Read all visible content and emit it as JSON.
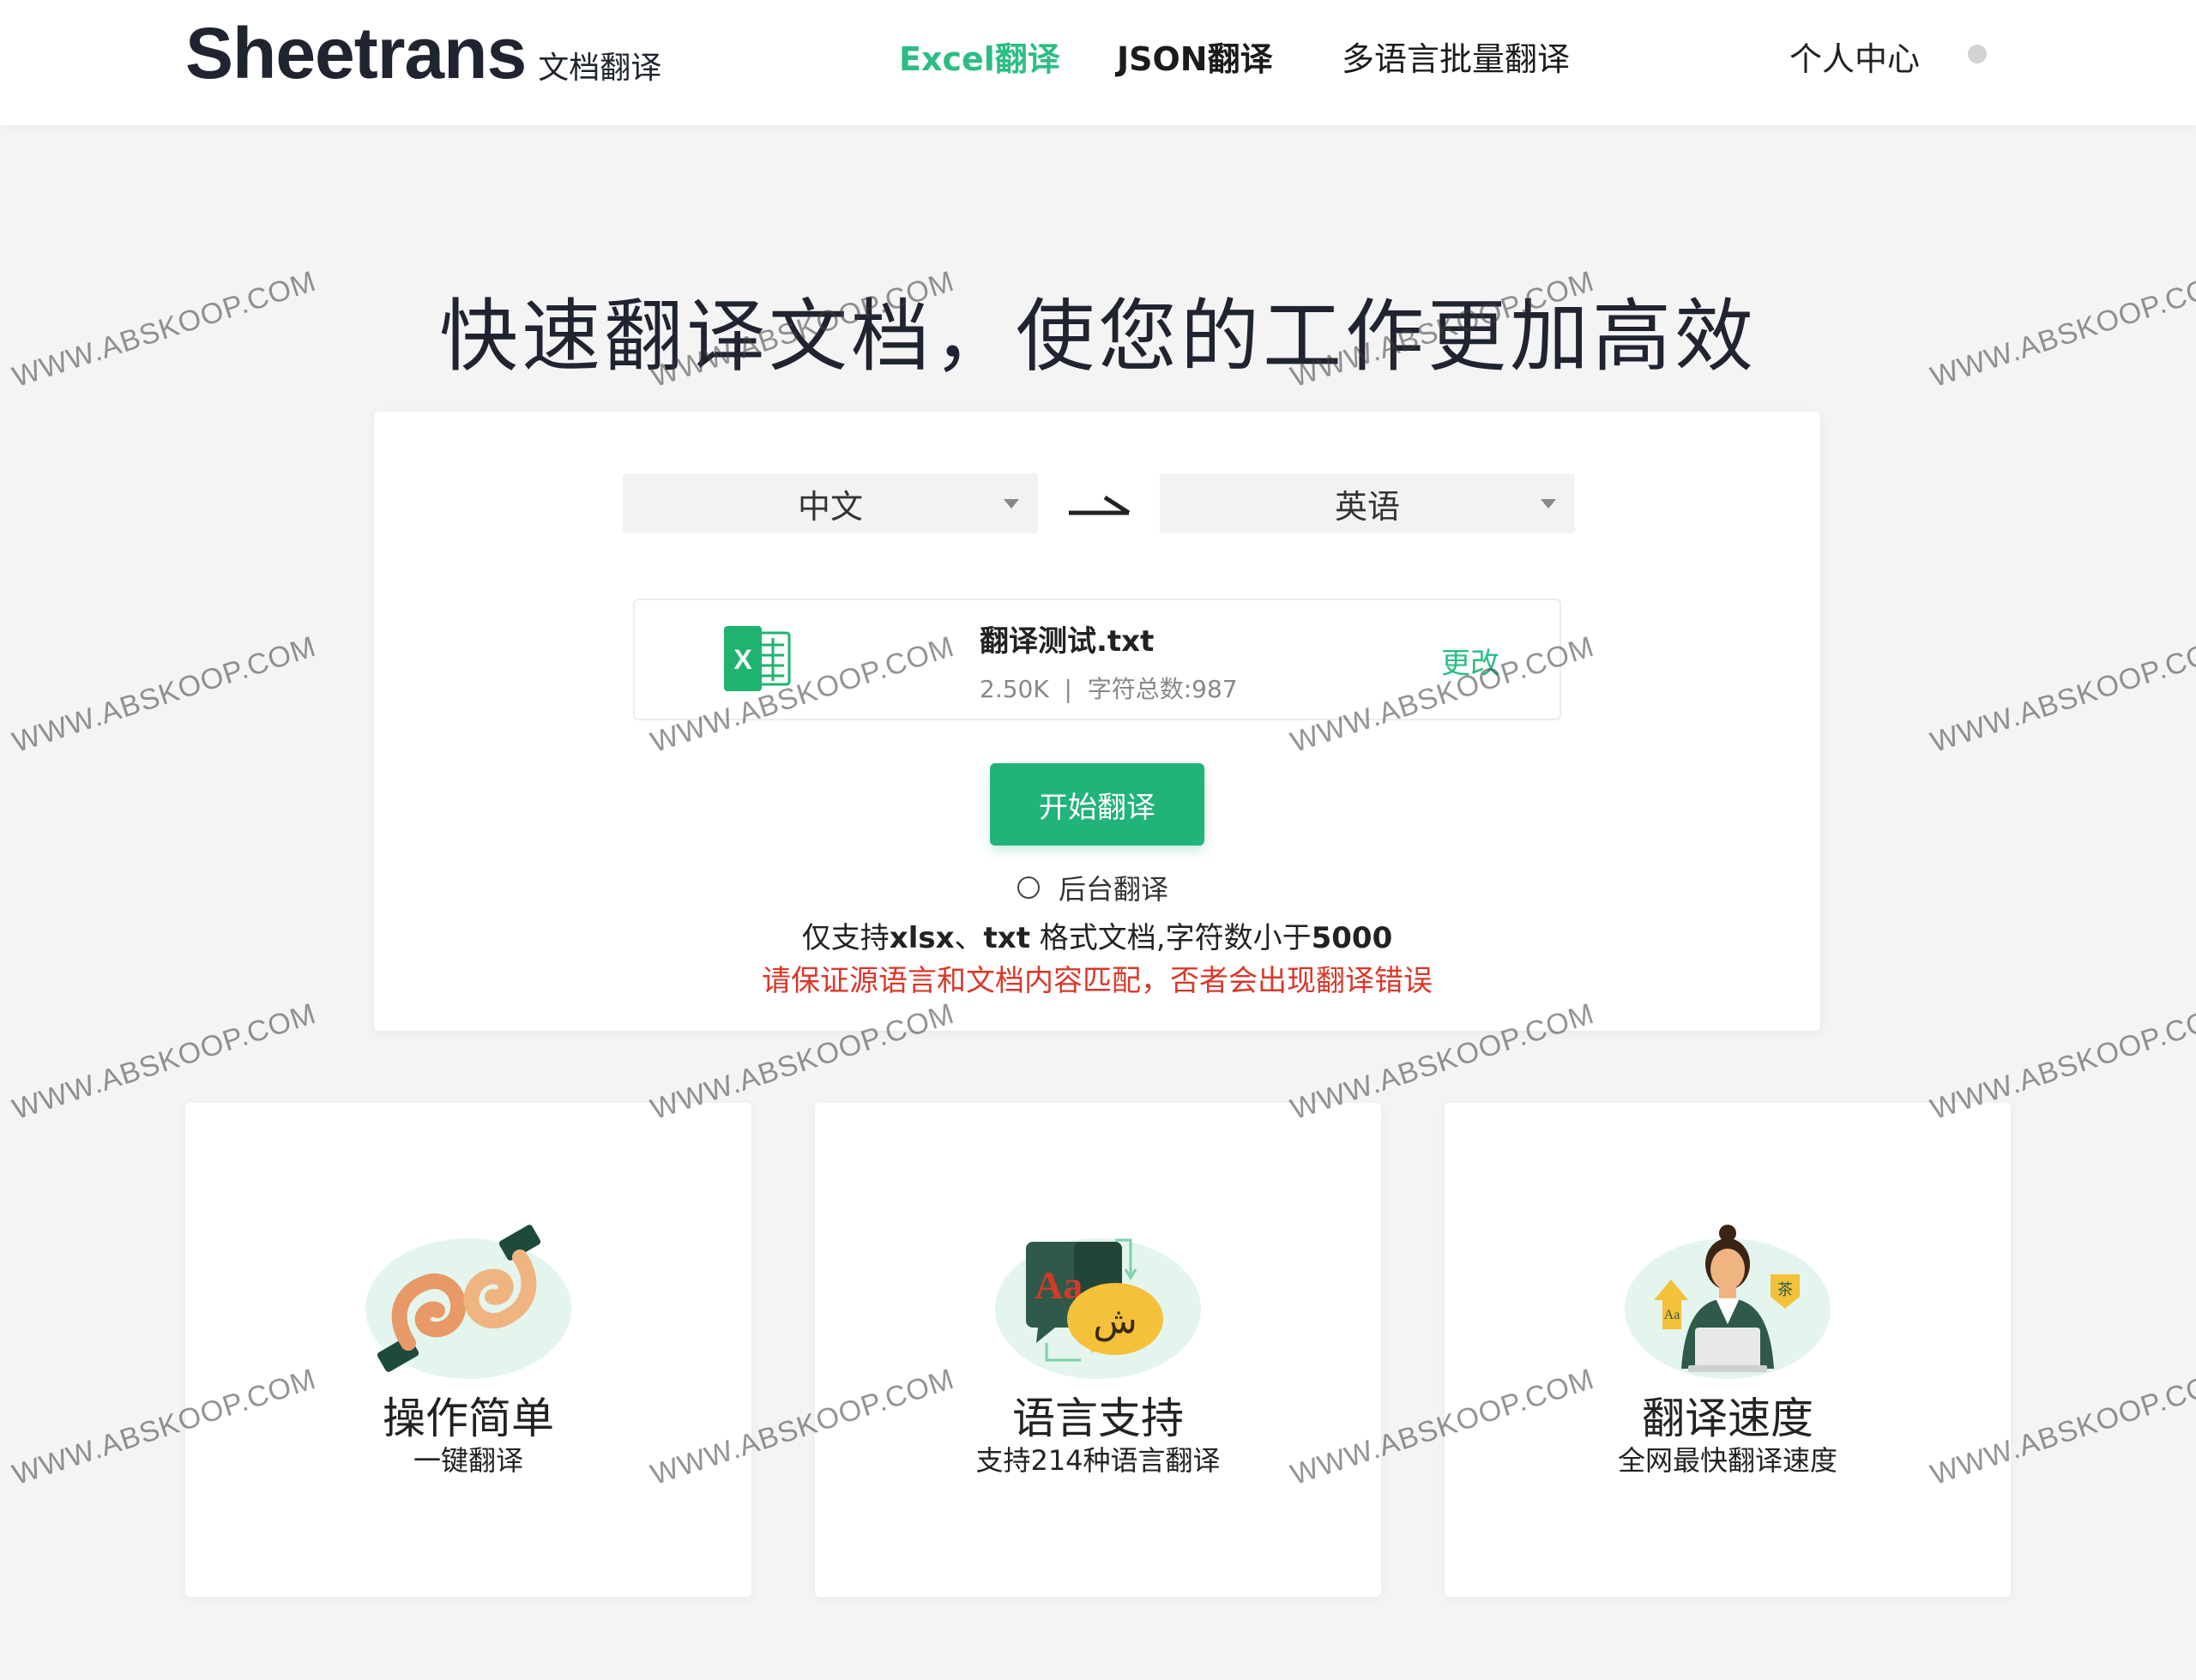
{
  "header": {
    "brand_name": "Sheetrans",
    "brand_sub": "文档翻译",
    "nav": [
      {
        "label": "Excel翻译",
        "active": true
      },
      {
        "label": "JSON翻译",
        "active": false
      },
      {
        "label": "多语言批量翻译",
        "active": false
      }
    ],
    "user_label": "个人中心"
  },
  "hero": {
    "title": "快速翻译文档，使您的工作更加高效"
  },
  "translator": {
    "source_lang": "中文",
    "target_lang": "英语",
    "file": {
      "name": "翻译测试.txt",
      "meta": "2.50K  |  字符总数:987",
      "change_label": "更改"
    },
    "start_label": "开始翻译",
    "background_label": "后台翻译",
    "support_prefix": "仅支持",
    "support_fmt1": "xlsx",
    "support_sep": "、",
    "support_fmt2": "txt",
    "support_mid": " 格式文档,字符数小于",
    "support_limit": "5000",
    "warning": "请保证源语言和文档内容匹配，否者会出现翻译错误"
  },
  "features": [
    {
      "title": "操作简单",
      "subtitle": "一键翻译",
      "icon": "hands-ok-icon"
    },
    {
      "title": "语言支持",
      "subtitle": "支持214种语言翻译",
      "icon": "language-bubbles-icon"
    },
    {
      "title": "翻译速度",
      "subtitle": "全网最快翻译速度",
      "icon": "translator-person-icon"
    }
  ],
  "watermark": "WWW.ABSKOOP.COM",
  "colors": {
    "accent": "#2dbd84",
    "button": "#22b37a",
    "warning": "#d8382a",
    "background": "#f4f4f5"
  }
}
